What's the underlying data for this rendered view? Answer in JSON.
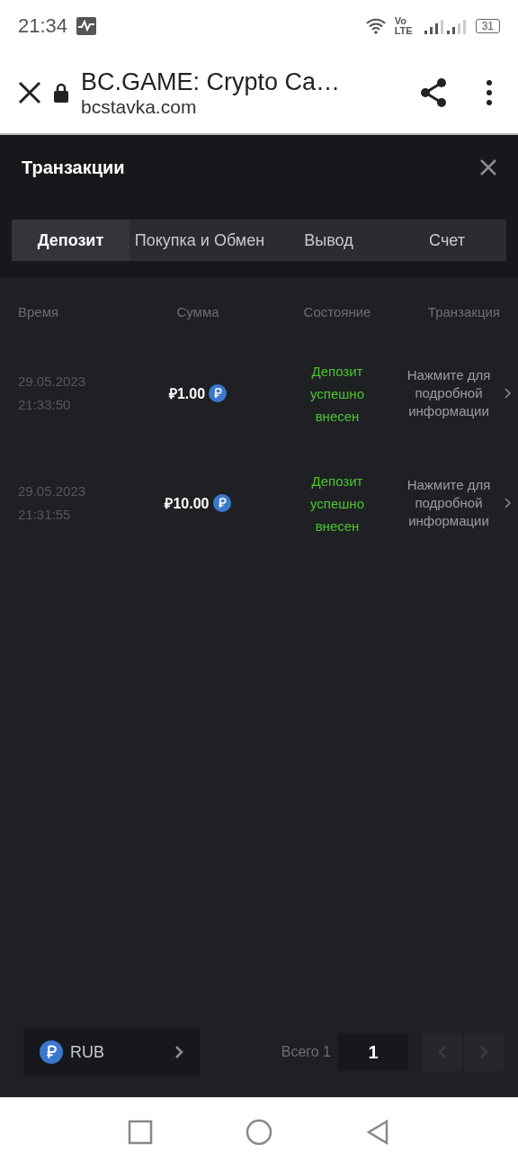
{
  "status_bar": {
    "time": "21:34",
    "network": "Vo LTE",
    "battery": "31"
  },
  "browser": {
    "title": "BC.GAME: Crypto Ca…",
    "url": "bcstavka.com"
  },
  "panel": {
    "title": "Транзакции"
  },
  "tabs": [
    {
      "label": "Депозит",
      "selected": true
    },
    {
      "label": "Покупка и Обмен",
      "selected": false
    },
    {
      "label": "Вывод",
      "selected": false
    },
    {
      "label": "Счет",
      "selected": false
    }
  ],
  "table": {
    "columns": [
      "Время",
      "Сумма",
      "Состояние",
      "Транзакция"
    ],
    "rows": [
      {
        "date": "29.05.2023",
        "time": "21:33:50",
        "amount": "₽1.00",
        "status": "Депозит успешно внесен",
        "details": "Нажмите для подробной информации"
      },
      {
        "date": "29.05.2023",
        "time": "21:31:55",
        "amount": "₽10.00",
        "status": "Депозит успешно внесен",
        "details": "Нажмите для подробной информации"
      }
    ]
  },
  "footer": {
    "currency": "RUB",
    "total": "Всего 1",
    "page": "1"
  }
}
